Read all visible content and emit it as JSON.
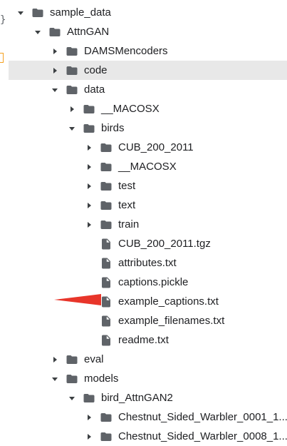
{
  "gutter": {
    "brace": "}"
  },
  "tree": {
    "items": [
      {
        "label": "sample_data",
        "kind": "folder",
        "state": "expanded",
        "depth": 0
      },
      {
        "label": "AttnGAN",
        "kind": "folder",
        "state": "expanded",
        "depth": 1
      },
      {
        "label": "DAMSMencoders",
        "kind": "folder",
        "state": "collapsed",
        "depth": 2
      },
      {
        "label": "code",
        "kind": "folder",
        "state": "collapsed",
        "depth": 2,
        "selected": true
      },
      {
        "label": "data",
        "kind": "folder",
        "state": "expanded",
        "depth": 2
      },
      {
        "label": "__MACOSX",
        "kind": "folder",
        "state": "collapsed",
        "depth": 3
      },
      {
        "label": "birds",
        "kind": "folder",
        "state": "expanded",
        "depth": 3
      },
      {
        "label": "CUB_200_2011",
        "kind": "folder",
        "state": "collapsed",
        "depth": 4
      },
      {
        "label": "__MACOSX",
        "kind": "folder",
        "state": "collapsed",
        "depth": 4
      },
      {
        "label": "test",
        "kind": "folder",
        "state": "collapsed",
        "depth": 4
      },
      {
        "label": "text",
        "kind": "folder",
        "state": "collapsed",
        "depth": 4
      },
      {
        "label": "train",
        "kind": "folder",
        "state": "collapsed",
        "depth": 4
      },
      {
        "label": "CUB_200_2011.tgz",
        "kind": "file",
        "depth": 4
      },
      {
        "label": "attributes.txt",
        "kind": "file",
        "depth": 4
      },
      {
        "label": "captions.pickle",
        "kind": "file",
        "depth": 4
      },
      {
        "label": "example_captions.txt",
        "kind": "file",
        "depth": 4,
        "annotated": true
      },
      {
        "label": "example_filenames.txt",
        "kind": "file",
        "depth": 4
      },
      {
        "label": "readme.txt",
        "kind": "file",
        "depth": 4
      },
      {
        "label": "eval",
        "kind": "folder",
        "state": "collapsed",
        "depth": 2
      },
      {
        "label": "models",
        "kind": "folder",
        "state": "expanded",
        "depth": 2
      },
      {
        "label": "bird_AttnGAN2",
        "kind": "folder",
        "state": "expanded",
        "depth": 3
      },
      {
        "label": "Chestnut_Sided_Warbler_0001_1...",
        "kind": "folder",
        "state": "collapsed",
        "depth": 4
      },
      {
        "label": "Chestnut_Sided_Warbler_0008_1...",
        "kind": "folder",
        "state": "collapsed",
        "depth": 4
      }
    ]
  },
  "colors": {
    "selected_row_bg": "#e8e8e8",
    "icon_gray": "#5f6368",
    "annotation_arrow": "#e8352a"
  },
  "icons": {
    "folder": "folder-icon",
    "file": "file-icon",
    "expanded": "caret-down-icon",
    "collapsed": "caret-right-icon"
  }
}
